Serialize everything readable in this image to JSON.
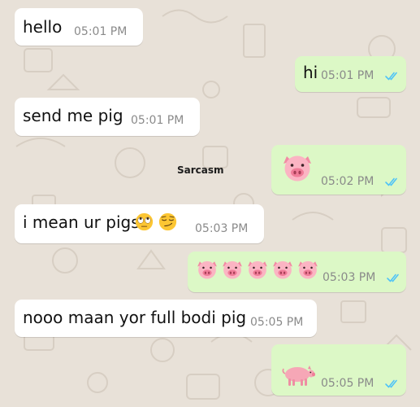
{
  "watermark": "Sarcasm",
  "messages": [
    {
      "direction": "incoming",
      "text": "hello",
      "time": "05:01 PM"
    },
    {
      "direction": "outgoing",
      "text": "hi",
      "time": "05:01 PM",
      "status": "read"
    },
    {
      "direction": "incoming",
      "text": "send me pig",
      "time": "05:01 PM"
    },
    {
      "direction": "outgoing",
      "emoji": [
        "pig-face"
      ],
      "time": "05:02 PM",
      "status": "read"
    },
    {
      "direction": "incoming",
      "text": "i mean ur pigs",
      "emoji": [
        "face-with-rolling-eyes",
        "smirking-face"
      ],
      "time": "05:03 PM"
    },
    {
      "direction": "outgoing",
      "emoji": [
        "pig-face",
        "pig-face",
        "pig-face",
        "pig-face",
        "pig-face"
      ],
      "time": "05:03 PM",
      "status": "read"
    },
    {
      "direction": "incoming",
      "text": "nooo maan yor full bodi pig",
      "time": "05:05 PM"
    },
    {
      "direction": "outgoing",
      "emoji": [
        "pig"
      ],
      "time": "05:05 PM",
      "status": "read"
    }
  ],
  "colors": {
    "background": "#e8e1d8",
    "incoming_bubble": "#ffffff",
    "outgoing_bubble": "#dcf8c6",
    "read_ticks": "#4fc3f7",
    "timestamp": "#8a8a8a"
  }
}
